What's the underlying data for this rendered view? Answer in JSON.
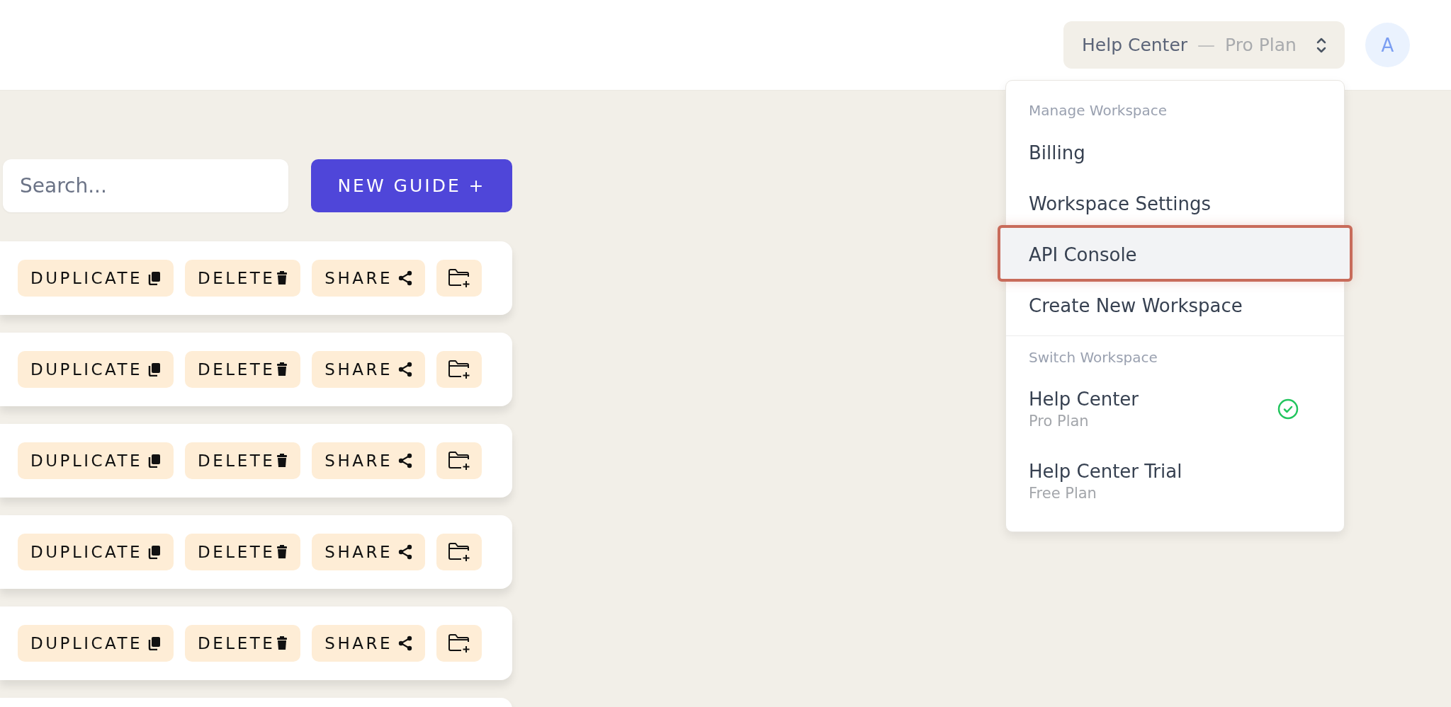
{
  "header": {
    "switcher": {
      "workspace": "Help Center",
      "separator": "—",
      "plan": "Pro Plan"
    },
    "avatar": {
      "initial": "A"
    }
  },
  "toolbar": {
    "search": {
      "placeholder": "Search..."
    },
    "new_button": "NEW GUIDE +"
  },
  "rows": [
    {
      "actions": [
        {
          "kind": "duplicate",
          "label": "DUPLICATE"
        },
        {
          "kind": "delete",
          "label": "DELETE"
        },
        {
          "kind": "share",
          "label": "SHARE"
        },
        {
          "kind": "folder"
        }
      ]
    },
    {
      "actions": [
        {
          "kind": "duplicate",
          "label": "DUPLICATE"
        },
        {
          "kind": "delete",
          "label": "DELETE"
        },
        {
          "kind": "share",
          "label": "SHARE"
        },
        {
          "kind": "folder"
        }
      ]
    },
    {
      "actions": [
        {
          "kind": "duplicate",
          "label": "DUPLICATE"
        },
        {
          "kind": "delete",
          "label": "DELETE"
        },
        {
          "kind": "share",
          "label": "SHARE"
        },
        {
          "kind": "folder"
        }
      ]
    },
    {
      "actions": [
        {
          "kind": "duplicate",
          "label": "DUPLICATE"
        },
        {
          "kind": "delete",
          "label": "DELETE"
        },
        {
          "kind": "share",
          "label": "SHARE"
        },
        {
          "kind": "folder"
        }
      ]
    },
    {
      "actions": [
        {
          "kind": "duplicate",
          "label": "DUPLICATE"
        },
        {
          "kind": "delete",
          "label": "DELETE"
        },
        {
          "kind": "share",
          "label": "SHARE"
        },
        {
          "kind": "folder"
        }
      ]
    }
  ],
  "menu": {
    "manage": {
      "title": "Manage Workspace",
      "items": [
        {
          "label": "Billing",
          "highlighted": false
        },
        {
          "label": "Workspace Settings",
          "highlighted": false
        },
        {
          "label": "API Console",
          "highlighted": true
        },
        {
          "label": "Create New Workspace",
          "highlighted": false
        }
      ]
    },
    "switch": {
      "title": "Switch Workspace",
      "workspaces": [
        {
          "name": "Help Center",
          "plan": "Pro Plan",
          "selected": true
        },
        {
          "name": "Help Center Trial",
          "plan": "Free Plan",
          "selected": false
        }
      ]
    }
  }
}
